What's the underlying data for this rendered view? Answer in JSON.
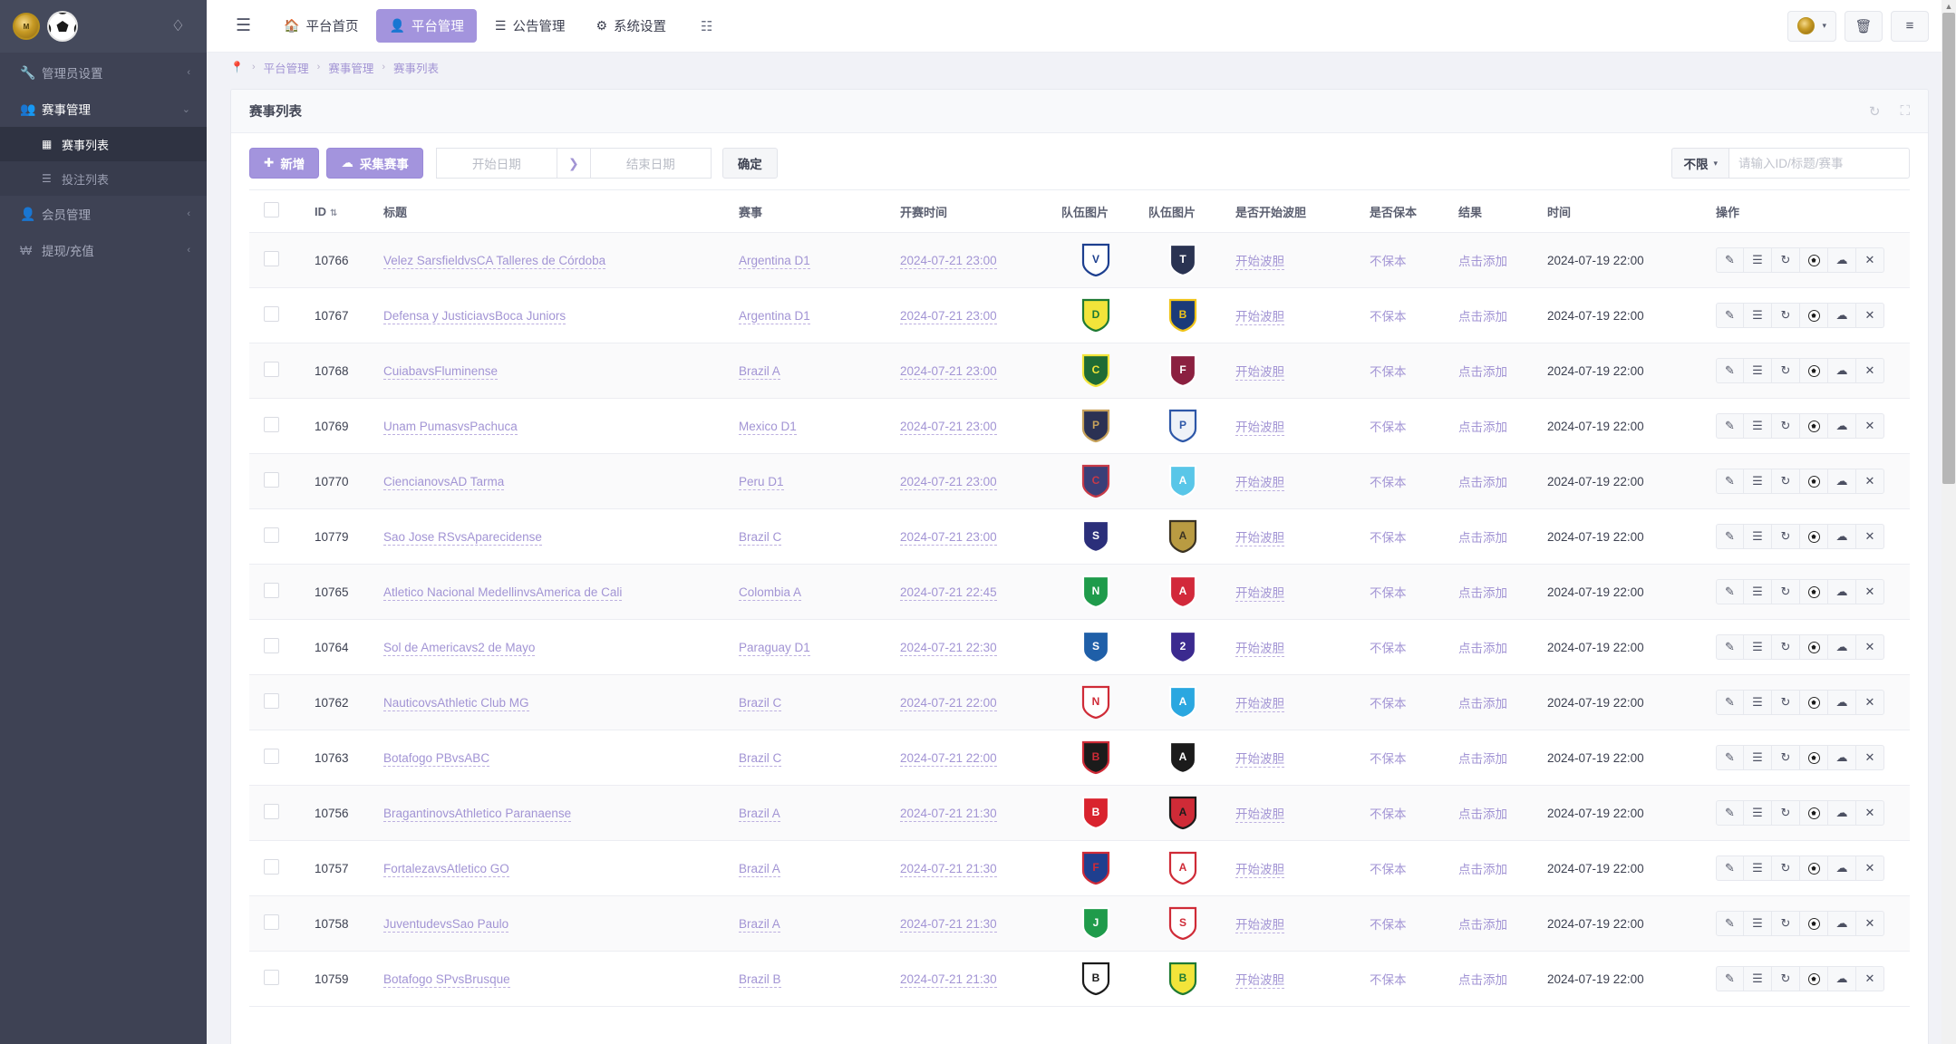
{
  "sidebar": {
    "logo": {
      "crest_label": "M",
      "ball_icon": "soccer-ball-icon",
      "drop_icon": "water-drop-icon"
    },
    "items": [
      {
        "icon": "wrench-icon",
        "label": "管理员设置",
        "arrow": "‹",
        "state": "collapsed"
      },
      {
        "icon": "users-icon",
        "label": "赛事管理",
        "arrow": "⌄",
        "state": "expanded"
      },
      {
        "icon": "person-icon",
        "label": "会员管理",
        "arrow": "‹",
        "state": "collapsed"
      },
      {
        "icon": "won-icon",
        "label": "提现/充值",
        "arrow": "‹",
        "state": "collapsed"
      }
    ],
    "sub_items": [
      {
        "icon": "table-icon",
        "label": "赛事列表",
        "active": true
      },
      {
        "icon": "list-icon",
        "label": "投注列表",
        "active": false
      }
    ]
  },
  "topbar": {
    "hamburger_icon": "hamburger-icon",
    "tabs": [
      {
        "icon": "home-icon",
        "label": "平台首页",
        "active": false
      },
      {
        "icon": "user-icon",
        "label": "平台管理",
        "active": true
      },
      {
        "icon": "announce-icon",
        "label": "公告管理",
        "active": false
      },
      {
        "icon": "gear-icon",
        "label": "系统设置",
        "active": false
      }
    ],
    "grid_icon": "grid-icon",
    "right": {
      "account_icon": "crest-avatar-icon",
      "account_caret": "▾",
      "trash_icon": "🗑",
      "panel_icon": "≡"
    }
  },
  "breadcrumb": {
    "pin_icon": "location-pin-icon",
    "sep": "›",
    "items": [
      "平台管理",
      "赛事管理",
      "赛事列表"
    ]
  },
  "card": {
    "title": "赛事列表",
    "refresh_icon": "refresh-icon",
    "expand_icon": "expand-icon"
  },
  "toolbar": {
    "add_label": "新增",
    "add_icon": "plus-circle-icon",
    "collect_label": "采集赛事",
    "collect_icon": "cloud-download-icon",
    "start_date_placeholder": "开始日期",
    "range_arrow": "❯",
    "end_date_placeholder": "结束日期",
    "confirm_label": "确定",
    "filter_label": "不限",
    "filter_caret": "▾",
    "search_placeholder": "请输入ID/标题/赛事",
    "search_value": ""
  },
  "table": {
    "headers": {
      "checkbox": "",
      "id": "ID",
      "sort_icon": "⇅",
      "title": "标题",
      "league": "赛事",
      "kickoff": "开赛时间",
      "logo_home": "队伍图片",
      "logo_away": "队伍图片",
      "bodan": "是否开始波胆",
      "baoben": "是否保本",
      "result": "结果",
      "time": "时间",
      "ops": "操作"
    },
    "op_icons": [
      "edit-icon",
      "list-icon",
      "refresh-icon",
      "soccer-ball-icon",
      "cloud-upload-icon",
      "close-icon"
    ],
    "rows": [
      {
        "id": "10766",
        "title": "Velez SarsfieldvsCA Talleres de Córdoba",
        "league": "Argentina D1",
        "kickoff": "2024-07-21 23:00",
        "home": "velez",
        "away": "talleres",
        "bodan": "开始波胆",
        "baoben": "不保本",
        "result": "点击添加",
        "time": "2024-07-19 22:00"
      },
      {
        "id": "10767",
        "title": "Defensa y JusticiavsBoca Juniors",
        "league": "Argentina D1",
        "kickoff": "2024-07-21 23:00",
        "home": "defensa",
        "away": "boca",
        "bodan": "开始波胆",
        "baoben": "不保本",
        "result": "点击添加",
        "time": "2024-07-19 22:00"
      },
      {
        "id": "10768",
        "title": "CuiabavsFluminense",
        "league": "Brazil A",
        "kickoff": "2024-07-21 23:00",
        "home": "cuiaba",
        "away": "fluminense",
        "bodan": "开始波胆",
        "baoben": "不保本",
        "result": "点击添加",
        "time": "2024-07-19 22:00"
      },
      {
        "id": "10769",
        "title": "Unam PumasvsPachuca",
        "league": "Mexico D1",
        "kickoff": "2024-07-21 23:00",
        "home": "pumas",
        "away": "pachuca",
        "bodan": "开始波胆",
        "baoben": "不保本",
        "result": "点击添加",
        "time": "2024-07-19 22:00"
      },
      {
        "id": "10770",
        "title": "CiencianovsAD Tarma",
        "league": "Peru D1",
        "kickoff": "2024-07-21 23:00",
        "home": "cienciano",
        "away": "tarma",
        "bodan": "开始波胆",
        "baoben": "不保本",
        "result": "点击添加",
        "time": "2024-07-19 22:00"
      },
      {
        "id": "10779",
        "title": "Sao Jose RSvsAparecidense",
        "league": "Brazil C",
        "kickoff": "2024-07-21 23:00",
        "home": "saojose",
        "away": "aparecidense",
        "bodan": "开始波胆",
        "baoben": "不保本",
        "result": "点击添加",
        "time": "2024-07-19 22:00"
      },
      {
        "id": "10765",
        "title": "Atletico Nacional MedellinvsAmerica de Cali",
        "league": "Colombia A",
        "kickoff": "2024-07-21 22:45",
        "home": "nacional",
        "away": "americacali",
        "bodan": "开始波胆",
        "baoben": "不保本",
        "result": "点击添加",
        "time": "2024-07-19 22:00"
      },
      {
        "id": "10764",
        "title": "Sol de Americavs2 de Mayo",
        "league": "Paraguay D1",
        "kickoff": "2024-07-21 22:30",
        "home": "soldeamerica",
        "away": "dosdemayo",
        "bodan": "开始波胆",
        "baoben": "不保本",
        "result": "点击添加",
        "time": "2024-07-19 22:00"
      },
      {
        "id": "10762",
        "title": "NauticovsAthletic Club MG",
        "league": "Brazil C",
        "kickoff": "2024-07-21 22:00",
        "home": "nautico",
        "away": "athleticmg",
        "bodan": "开始波胆",
        "baoben": "不保本",
        "result": "点击添加",
        "time": "2024-07-19 22:00"
      },
      {
        "id": "10763",
        "title": "Botafogo PBvsABC",
        "league": "Brazil C",
        "kickoff": "2024-07-21 22:00",
        "home": "botafogopb",
        "away": "abc",
        "bodan": "开始波胆",
        "baoben": "不保本",
        "result": "点击添加",
        "time": "2024-07-19 22:00"
      },
      {
        "id": "10756",
        "title": "BragantinovsAthletico Paranaense",
        "league": "Brazil A",
        "kickoff": "2024-07-21 21:30",
        "home": "bragantino",
        "away": "paranaense",
        "bodan": "开始波胆",
        "baoben": "不保本",
        "result": "点击添加",
        "time": "2024-07-19 22:00"
      },
      {
        "id": "10757",
        "title": "FortalezavsAtletico GO",
        "league": "Brazil A",
        "kickoff": "2024-07-21 21:30",
        "home": "fortaleza",
        "away": "atleticogo",
        "bodan": "开始波胆",
        "baoben": "不保本",
        "result": "点击添加",
        "time": "2024-07-19 22:00"
      },
      {
        "id": "10758",
        "title": "JuventudevsSao Paulo",
        "league": "Brazil A",
        "kickoff": "2024-07-21 21:30",
        "home": "juventude",
        "away": "saopaulo",
        "bodan": "开始波胆",
        "baoben": "不保本",
        "result": "点击添加",
        "time": "2024-07-19 22:00"
      },
      {
        "id": "10759",
        "title": "Botafogo SPvsBrusque",
        "league": "Brazil B",
        "kickoff": "2024-07-21 21:30",
        "home": "botafogosp",
        "away": "brusque",
        "bodan": "开始波胆",
        "baoben": "不保本",
        "result": "点击添加",
        "time": "2024-07-19 22:00"
      }
    ]
  },
  "colors": {
    "accent_purple": "#a394dd",
    "sidebar_bg": "#3e4254",
    "link_purple": "#a294d4"
  }
}
